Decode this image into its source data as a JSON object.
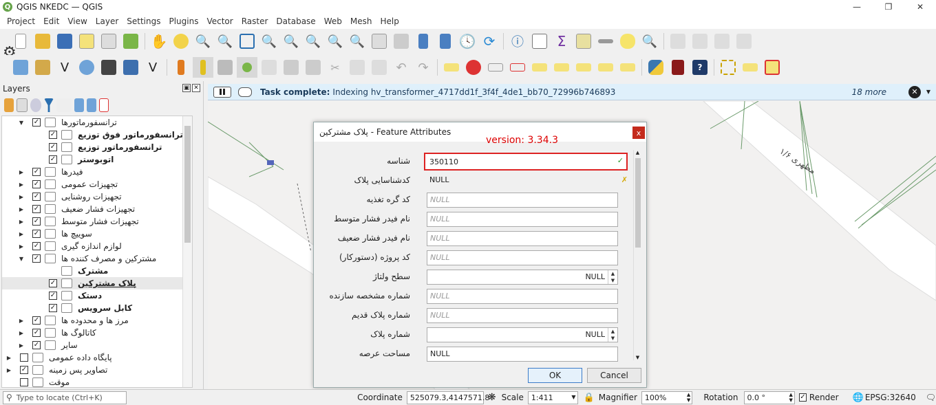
{
  "window": {
    "title": "QGIS NKEDC — QGIS"
  },
  "menu": [
    "Project",
    "Edit",
    "View",
    "Layer",
    "Settings",
    "Plugins",
    "Vector",
    "Raster",
    "Database",
    "Web",
    "Mesh",
    "Help"
  ],
  "layers_panel": {
    "title": "Layers",
    "tree": [
      {
        "label": "ترانسفورماتورها",
        "arrow": "▼",
        "check": "✓",
        "indent": 1,
        "bold": false
      },
      {
        "label": "ترانسفورماتور فوق توزیع",
        "arrow": "",
        "check": "✓",
        "indent": 2,
        "bold": true
      },
      {
        "label": "ترانسفورماتور توزیع",
        "arrow": "",
        "check": "✓",
        "indent": 2,
        "bold": true
      },
      {
        "label": "اتوبوستر",
        "arrow": "",
        "check": "✓",
        "indent": 2,
        "bold": true
      },
      {
        "label": "فیدرها",
        "arrow": "▶",
        "check": "✓",
        "indent": 1,
        "bold": false
      },
      {
        "label": "تجهیزات عمومی",
        "arrow": "▶",
        "check": "✓",
        "indent": 1,
        "bold": false
      },
      {
        "label": "تجهیزات روشنایی",
        "arrow": "▶",
        "check": "✓",
        "indent": 1,
        "bold": false
      },
      {
        "label": "تجهیزات فشار ضعیف",
        "arrow": "▶",
        "check": "✓",
        "indent": 1,
        "bold": false
      },
      {
        "label": "تجهیزات فشار متوسط",
        "arrow": "▶",
        "check": "✓",
        "indent": 1,
        "bold": false
      },
      {
        "label": "سوییچ ها",
        "arrow": "▶",
        "check": "✓",
        "indent": 1,
        "bold": false
      },
      {
        "label": "لوازم اندازه گیری",
        "arrow": "▶",
        "check": "✓",
        "indent": 1,
        "bold": false
      },
      {
        "label": "مشترکین و مصرف کننده ها",
        "arrow": "▼",
        "check": "✓",
        "indent": 1,
        "bold": false
      },
      {
        "label": "مشترک",
        "arrow": "",
        "check": "",
        "indent": 2,
        "bold": true
      },
      {
        "label": "پلاک مشترکین",
        "arrow": "",
        "check": "✓",
        "indent": 2,
        "bold": true,
        "sel": true
      },
      {
        "label": "دستک",
        "arrow": "",
        "check": "✓",
        "indent": 2,
        "bold": true
      },
      {
        "label": "کابل سرویس",
        "arrow": "",
        "check": "✓",
        "indent": 2,
        "bold": true
      },
      {
        "label": "مرز ها و محدوده ها",
        "arrow": "▶",
        "check": "✓",
        "indent": 1,
        "bold": false
      },
      {
        "label": "کاتالوگ ها",
        "arrow": "▶",
        "check": "✓",
        "indent": 1,
        "bold": false
      },
      {
        "label": "سایر",
        "arrow": "▶",
        "check": "✓",
        "indent": 1,
        "bold": false
      },
      {
        "label": "پایگاه داده عمومی",
        "arrow": "▶",
        "check": "",
        "indent": 0,
        "bold": false
      },
      {
        "label": "تصاویر پس زمینه",
        "arrow": "▶",
        "check": "✓",
        "indent": 0,
        "bold": false
      },
      {
        "label": "موقت",
        "arrow": "",
        "check": "",
        "indent": 0,
        "bold": false
      }
    ]
  },
  "infobar": {
    "bold": "Task complete:",
    "message": "Indexing hv_transformer_4717dd1f_3f4f_4de1_bb70_72996b746893",
    "more": "18 more"
  },
  "map": {
    "road_label": "مطهری ۱/۶"
  },
  "dialog": {
    "title": "پلاک مشترکین - Feature Attributes",
    "version": "version: 3.34.3",
    "fields": [
      {
        "label": "شناسه",
        "value": "350110",
        "kind": "id"
      },
      {
        "label": "کدشناسایی پلاک",
        "value": "NULL",
        "kind": "ro"
      },
      {
        "label": "کد گره تغذیه",
        "value": "NULL",
        "kind": "null"
      },
      {
        "label": "نام فیدر فشار متوسط",
        "value": "NULL",
        "kind": "null"
      },
      {
        "label": "نام فیدر فشار ضعیف",
        "value": "NULL",
        "kind": "null"
      },
      {
        "label": "کد پروژه (دستورکار)",
        "value": "NULL",
        "kind": "null"
      },
      {
        "label": "سطح ولتاژ",
        "value": "NULL",
        "kind": "spin"
      },
      {
        "label": "شماره مشخصه سازنده",
        "value": "NULL",
        "kind": "null"
      },
      {
        "label": "شماره پلاک قدیم",
        "value": "NULL",
        "kind": "null"
      },
      {
        "label": "شماره پلاک",
        "value": "NULL",
        "kind": "spin"
      },
      {
        "label": "مساحت عرصه",
        "value": "NULL",
        "kind": "plain"
      }
    ],
    "ok": "OK",
    "cancel": "Cancel"
  },
  "statusbar": {
    "locate_placeholder": "Type to locate (Ctrl+K)",
    "coordinate_label": "Coordinate",
    "coordinate": "525079.3,4147571.8",
    "scale_label": "Scale",
    "scale": "1:411",
    "magnifier_label": "Magnifier",
    "magnifier": "100%",
    "rotation_label": "Rotation",
    "rotation": "0.0 °",
    "render_label": "Render",
    "crs": "EPSG:32640"
  }
}
